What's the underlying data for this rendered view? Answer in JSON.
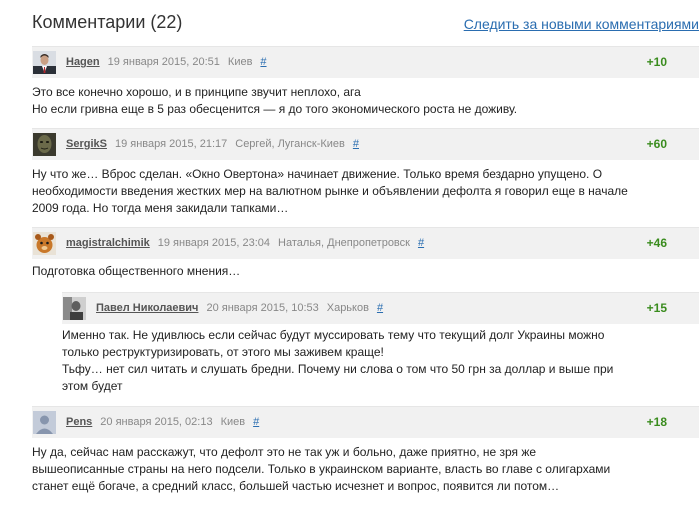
{
  "header": {
    "title": "Комментарии (22)",
    "follow_link": "Следить за новыми комментариями"
  },
  "comments": [
    {
      "user": "Hagen",
      "date": "19 января 2015, 20:51",
      "location": "Киев",
      "anchor": "#",
      "score": "+10",
      "avatar": "user-photo-suit",
      "lines": [
        "Это все конечно хорошо, и в принципе звучит неплохо, ага",
        "Но если гривна еще в 5 раз обесценится — я до того экономического роста не доживу."
      ]
    },
    {
      "user": "SergikS",
      "date": "19 января 2015, 21:17",
      "location": "Сергей, Луганск-Киев",
      "anchor": "#",
      "score": "+60",
      "avatar": "user-photo-dark",
      "lines": [
        "Ну что же… Вброс сделан. «Окно Овертона» начинает движение. Только время бездарно упущено. О",
        "необходимости введения жестких мер на валютном рынке и объявлении дефолта я говорил еще в начале",
        "2009 года. Но тогда меня закидали тапками…"
      ]
    },
    {
      "user": "magistralchimik",
      "date": "19 января 2015, 23:04",
      "location": "Наталья, Днепропетровск",
      "anchor": "#",
      "score": "+46",
      "avatar": "user-photo-animal",
      "lines": [
        "Подготовка общественного мнения…"
      ]
    },
    {
      "user": "Павел Николаевич",
      "date": "20 января 2015, 10:53",
      "location": "Харьков",
      "anchor": "#",
      "score": "+15",
      "avatar": "user-photo-gray",
      "lines": [
        "Именно так. Не удивлюсь если сейчас будут муссировать тему что текущий долг Украины можно",
        "только реструктуризировать, от этого мы заживем краще!",
        "Тьфу… нет сил читать и слушать бредни. Почему ни слова о том что 50 грн за доллар и выше при",
        "этом будет"
      ]
    },
    {
      "user": "Pens",
      "date": "20 января 2015, 02:13",
      "location": "Киев",
      "anchor": "#",
      "score": "+18",
      "avatar": "default-avatar-icon",
      "lines": [
        "Ну да, сейчас нам расскажут, что дефолт это не так уж и больно, даже приятно, не зря же",
        "вышеописанные страны на него подсели. Только в украинском варианте, власть во главе с олигархами",
        "станет ещё богаче, а средний класс, большей частью исчезнет и вопрос, появится ли потом…"
      ]
    }
  ]
}
